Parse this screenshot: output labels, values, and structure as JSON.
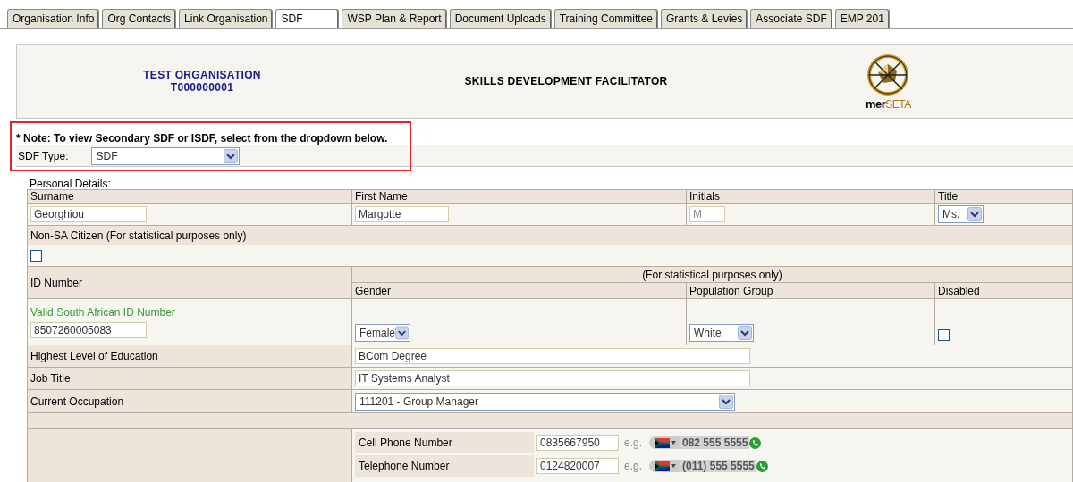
{
  "tabs": [
    {
      "label": "Organisation Info",
      "selected": false
    },
    {
      "label": "Org Contacts",
      "selected": false
    },
    {
      "label": "Link Organisation",
      "selected": false
    },
    {
      "label": "SDF",
      "selected": true
    },
    {
      "label": "WSP Plan & Report",
      "selected": false
    },
    {
      "label": "Document Uploads",
      "selected": false
    },
    {
      "label": "Training Committee",
      "selected": false
    },
    {
      "label": "Grants & Levies",
      "selected": false
    },
    {
      "label": "Associate SDF",
      "selected": false
    },
    {
      "label": "EMP 201",
      "selected": false
    }
  ],
  "header": {
    "org_name": "TEST ORGANISATION",
    "org_code": "T000000001",
    "title": "SKILLS DEVELOPMENT FACILITATOR",
    "logo": {
      "text_dark": "mer",
      "text_accent": "SETA"
    }
  },
  "note": "* Note: To view Secondary SDF or ISDF, select from the dropdown below.",
  "sdf_type": {
    "label": "SDF Type:",
    "value": "SDF"
  },
  "personal_details": {
    "label": "Personal Details:",
    "surname": {
      "label": "Surname",
      "value": "Georghiou"
    },
    "first_name": {
      "label": "First Name",
      "value": "Margotte"
    },
    "initials": {
      "label": "Initials",
      "value": "M"
    },
    "title": {
      "label": "Title",
      "value": "Ms."
    },
    "non_sa_citizen": {
      "label": "Non-SA Citizen (For statistical purposes only)",
      "checked": false
    },
    "id_number": {
      "label": "ID Number",
      "status": "Valid South African ID Number",
      "value": "8507260005083"
    },
    "statistical_note": "(For statistical purposes only)",
    "gender": {
      "label": "Gender",
      "value": "Female"
    },
    "population_group": {
      "label": "Population Group",
      "value": "White"
    },
    "disabled": {
      "label": "Disabled",
      "checked": false
    },
    "education": {
      "label": "Highest Level of Education",
      "value": "BCom Degree"
    },
    "job_title": {
      "label": "Job Title",
      "value": "IT Systems Analyst"
    },
    "occupation": {
      "label": "Current Occupation",
      "value": "111201 - Group Manager"
    },
    "phones": [
      {
        "label": "Cell Phone Number",
        "value": "0835667950",
        "eg": "e.g.",
        "example": "082 555 5555"
      },
      {
        "label": "Telephone Number",
        "value": "0124820007",
        "eg": "e.g.",
        "example": "(011) 555 5555"
      }
    ]
  }
}
